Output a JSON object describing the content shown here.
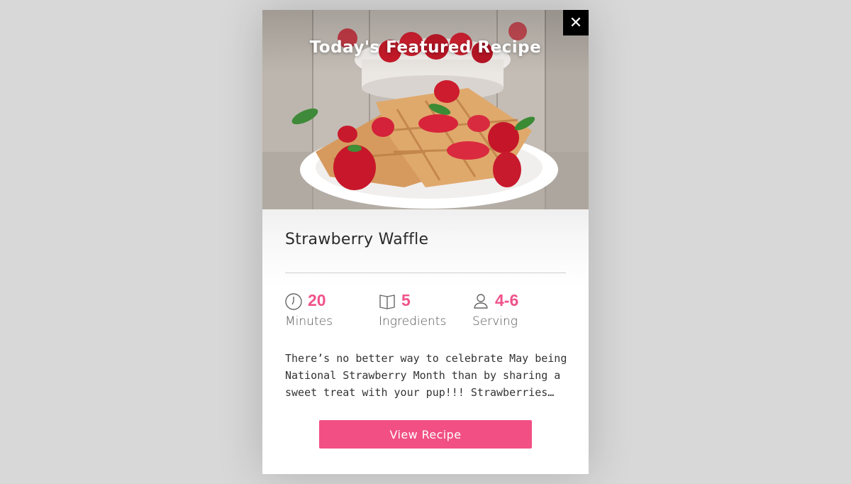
{
  "hero": {
    "title": "Today's Featured Recipe",
    "image": "strawberry-waffle-photo"
  },
  "close": {
    "icon": "close-icon",
    "label": "✕"
  },
  "recipe": {
    "title": "Strawberry Waffle",
    "stats": [
      {
        "icon": "clock-icon",
        "value": "20",
        "label": "Minutes"
      },
      {
        "icon": "book-icon",
        "value": "5",
        "label": "Ingredients"
      },
      {
        "icon": "person-icon",
        "value": "4-6",
        "label": "Serving"
      }
    ],
    "description": "There’s no better way to celebrate May being National Strawberry Month than by sharing a sweet treat with your pup!!! Strawberries…",
    "button_label": "View Recipe"
  },
  "colors": {
    "accent": "#f24f85",
    "stat_value": "#f0528a",
    "overlay": "#d8d8d8",
    "close_bg": "#000000"
  }
}
